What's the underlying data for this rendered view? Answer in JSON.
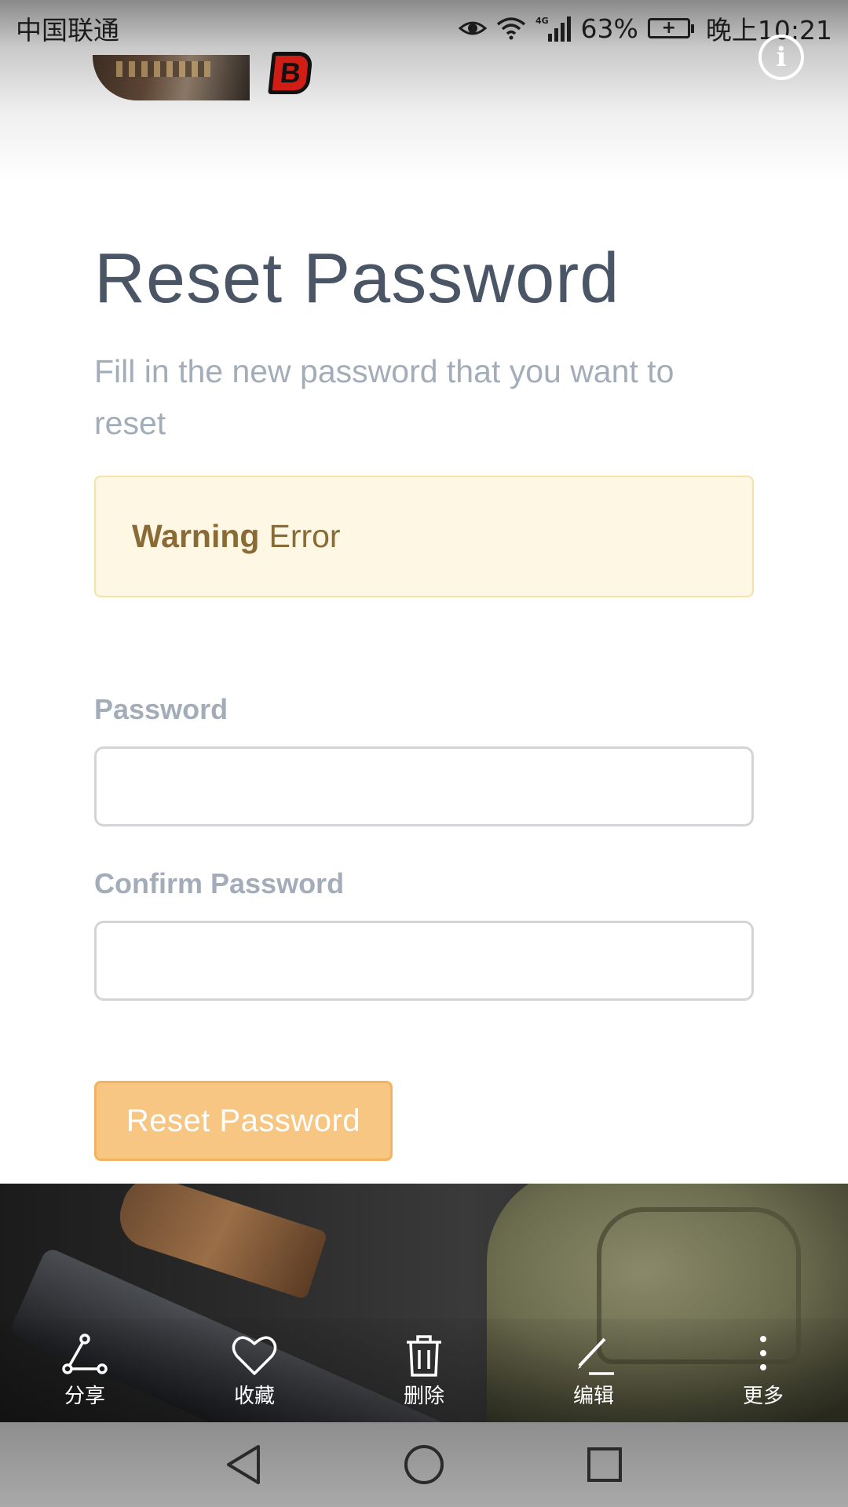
{
  "status_bar": {
    "carrier": "中国联通",
    "network": "4G",
    "battery_percent": "63%",
    "time": "晚上10:21"
  },
  "header": {
    "logo_letter": "B",
    "info_icon": "info-icon"
  },
  "form": {
    "title": "Reset Password",
    "subtitle": "Fill in the new password that you want to reset",
    "alert": {
      "strong": "Warning",
      "message": "Error"
    },
    "password_label": "Password",
    "password_value": "",
    "confirm_label": "Confirm Password",
    "confirm_value": "",
    "submit_label": "Reset Password"
  },
  "toolbar": {
    "items": [
      {
        "label": "分享",
        "icon": "share-icon"
      },
      {
        "label": "收藏",
        "icon": "heart-icon"
      },
      {
        "label": "删除",
        "icon": "trash-icon"
      },
      {
        "label": "编辑",
        "icon": "pencil-icon"
      },
      {
        "label": "更多",
        "icon": "more-vertical-icon"
      }
    ]
  },
  "colors": {
    "title": "#4a5566",
    "muted": "#a3acb9",
    "alert_bg": "#fdf7e4",
    "alert_text": "#8a6a35",
    "button_bg": "#f6c682"
  }
}
